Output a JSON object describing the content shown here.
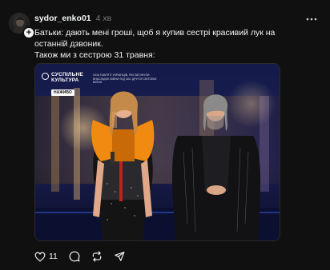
{
  "post": {
    "username": "sydor_enko01",
    "timestamp": "4 хв",
    "caption_lines": [
      "Батьки: дають мені гроші, щоб я купив сестрі красивий лук на",
      "останній дзвоник.",
      "Також ми з сестрою 31 травня:"
    ],
    "media": {
      "logo_line1": "СУСПІЛЬНЕ",
      "logo_line2": "КУЛЬТУРА",
      "live_badge": "НАЖИВО",
      "broadcast_note": "2016 ПАМ'ЯТІ УКРАЇНЦІВ, ЯКІ ЗАГИНУЛИ ВНАСЛІДОК ВІЙНИ ПІД ЧАС ДРУГОЇ СВІТОВОЇ ВІЙНИ"
    },
    "likes": "11"
  },
  "icons": {
    "avatar": "avatar-image",
    "follow": "plus-icon",
    "more": "more-icon",
    "like": "heart-icon",
    "comment": "comment-icon",
    "repost": "repost-icon",
    "share": "share-icon"
  },
  "colors": {
    "background": "#101010",
    "text": "#f3f5f7",
    "secondary_text": "#777777"
  }
}
